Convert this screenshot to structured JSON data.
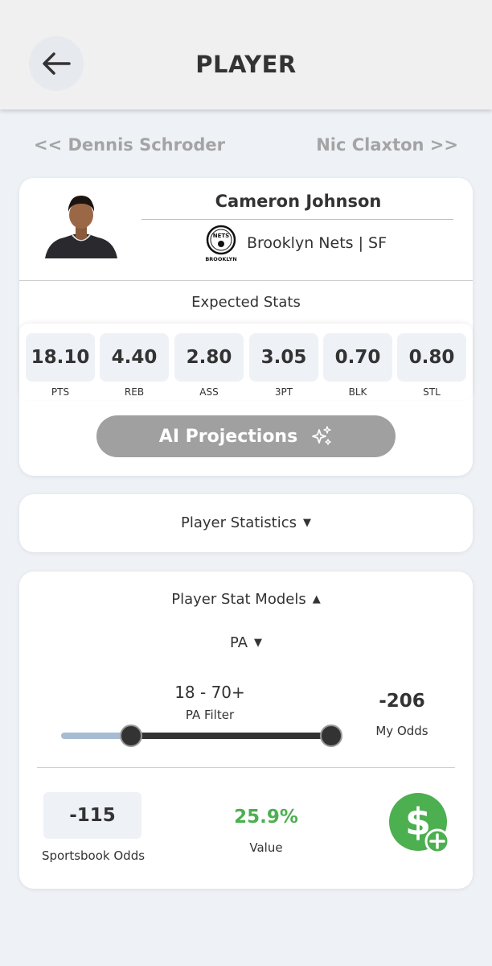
{
  "header": {
    "title": "PLAYER",
    "back_icon": "arrow-left-icon"
  },
  "nav": {
    "prev": "<<  Dennis Schroder",
    "next": "Nic Claxton  >>"
  },
  "player": {
    "name": "Cameron Johnson",
    "team": "Brooklyn Nets",
    "position": "SF",
    "team_line": "Brooklyn Nets  |  SF",
    "logo_text": "NETS",
    "logo_subtext": "BROOKLYN"
  },
  "expected_stats": {
    "title": "Expected Stats",
    "items": [
      {
        "value": "18.10",
        "label": "PTS"
      },
      {
        "value": "4.40",
        "label": "REB"
      },
      {
        "value": "2.80",
        "label": "ASS"
      },
      {
        "value": "3.05",
        "label": "3PT"
      },
      {
        "value": "0.70",
        "label": "BLK"
      },
      {
        "value": "0.80",
        "label": "STL"
      }
    ]
  },
  "ai_button": {
    "label": "AI Projections",
    "icon": "sparkles-icon"
  },
  "player_statistics": {
    "label": "Player Statistics",
    "state": "collapsed"
  },
  "stat_models": {
    "label": "Player Stat Models",
    "state": "expanded",
    "stat_select": "PA",
    "range": "18 - 70+",
    "range_min": 18,
    "range_max": 70,
    "filter_label": "PA Filter",
    "my_odds": "-206",
    "my_odds_label": "My Odds",
    "sportsbook_odds": "-115",
    "sportsbook_label": "Sportsbook Odds",
    "value": "25.9%",
    "value_label": "Value",
    "add_icon": "dollar-plus-icon"
  },
  "colors": {
    "accent_green": "#4caf50",
    "button_gray": "#a0a0a0",
    "background": "#eef1f5"
  }
}
